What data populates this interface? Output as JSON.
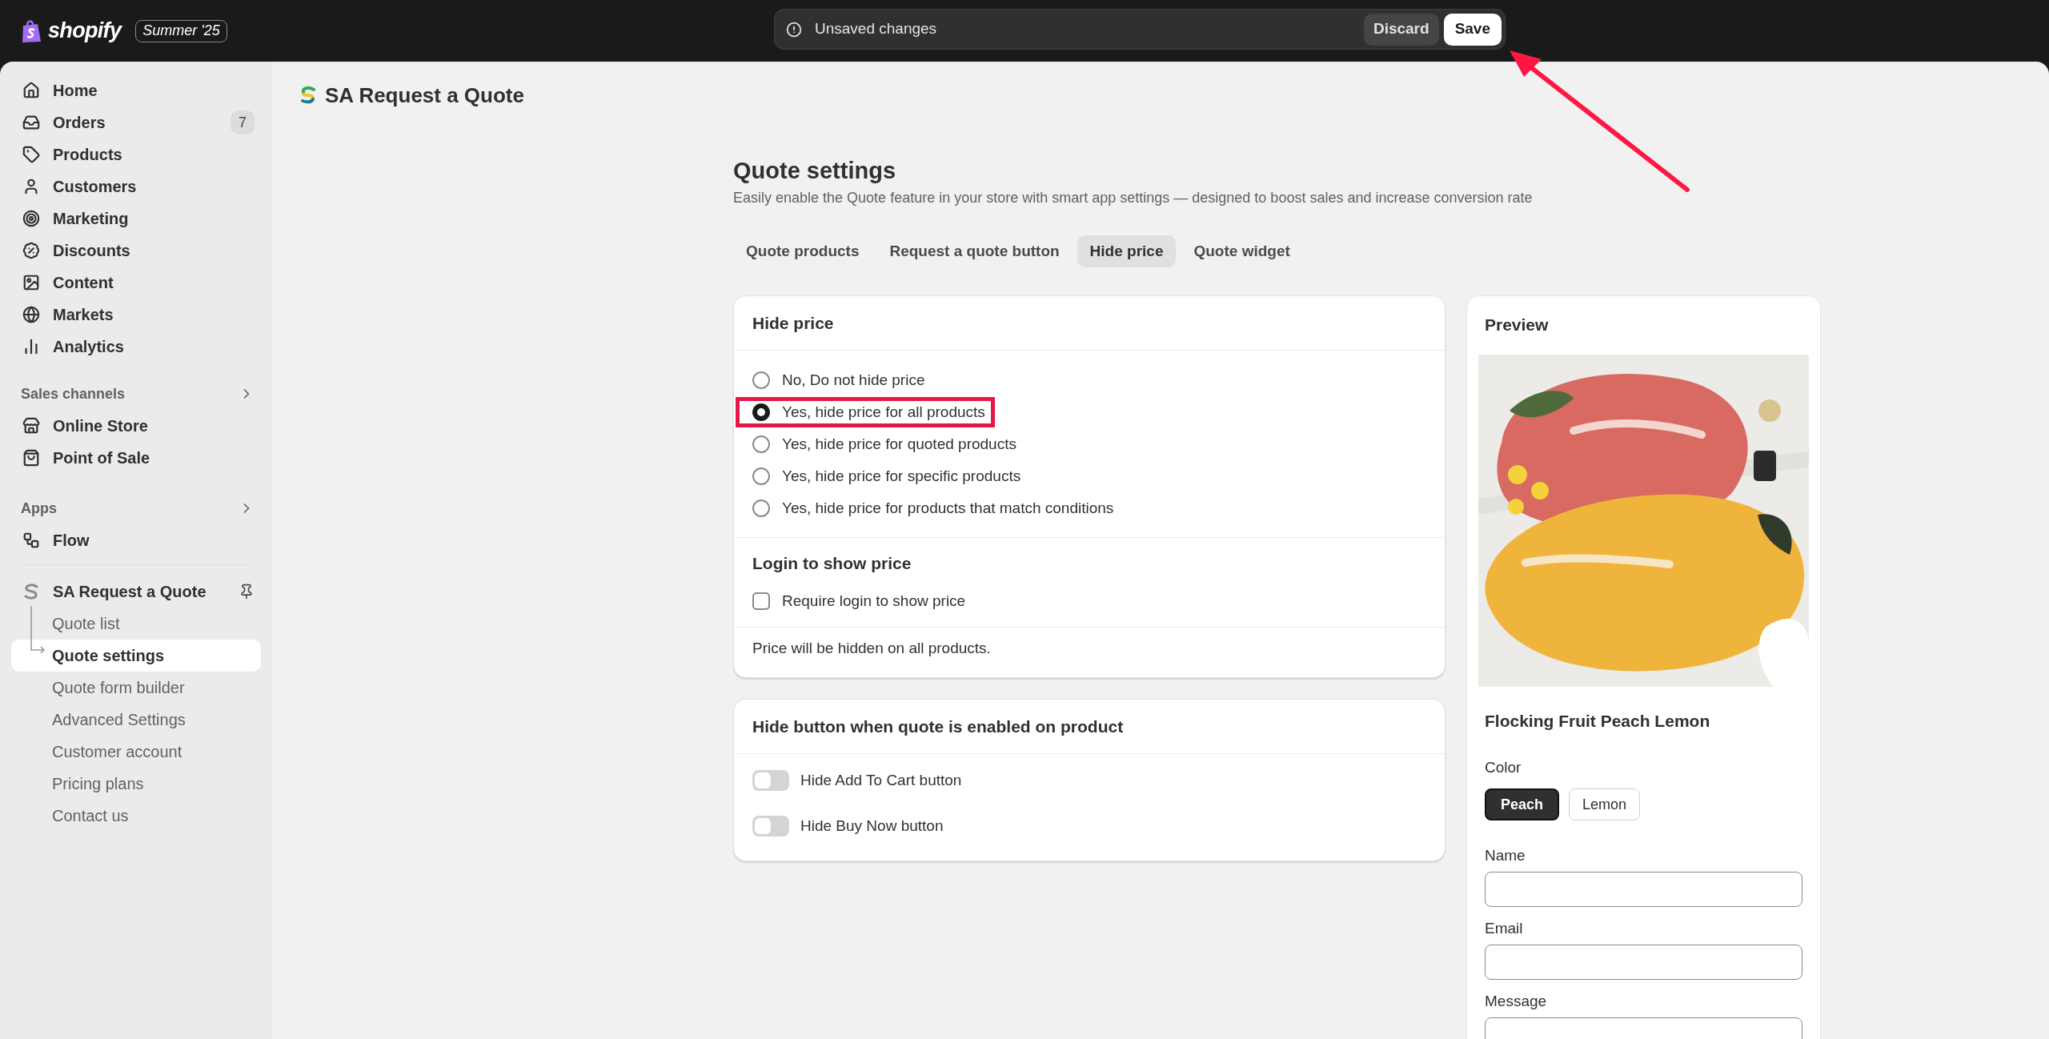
{
  "topbar": {
    "brand": "shopify",
    "edition": "Summer '25",
    "notice": "Unsaved changes",
    "buttons": [
      {
        "label": "Discard",
        "kind": "secondary"
      },
      {
        "label": "Save",
        "kind": "primary"
      }
    ]
  },
  "sidebar": {
    "items": [
      {
        "label": "Home"
      },
      {
        "label": "Orders",
        "badge": "7"
      },
      {
        "label": "Products"
      },
      {
        "label": "Customers"
      },
      {
        "label": "Marketing"
      },
      {
        "label": "Discounts"
      },
      {
        "label": "Content"
      },
      {
        "label": "Markets"
      },
      {
        "label": "Analytics"
      }
    ],
    "sections": [
      {
        "title": "Sales channels",
        "items": [
          {
            "label": "Online Store"
          },
          {
            "label": "Point of Sale"
          }
        ]
      },
      {
        "title": "Apps",
        "items": [
          {
            "label": "Flow"
          }
        ]
      }
    ],
    "app": {
      "name": "SA Request a Quote",
      "children": [
        {
          "label": "Quote list",
          "selected": false
        },
        {
          "label": "Quote settings",
          "selected": true
        },
        {
          "label": "Quote form builder",
          "selected": false
        },
        {
          "label": "Advanced Settings",
          "selected": false
        },
        {
          "label": "Customer account",
          "selected": false
        },
        {
          "label": "Pricing plans",
          "selected": false
        },
        {
          "label": "Contact us",
          "selected": false
        }
      ]
    }
  },
  "header": {
    "app_title": "SA Request a Quote"
  },
  "page": {
    "title": "Quote settings",
    "subtitle": "Easily enable the Quote feature in your store with smart app settings — designed to boost sales and increase conversion rate",
    "tabs": [
      {
        "label": "Quote products",
        "selected": false
      },
      {
        "label": "Request a quote button",
        "selected": false
      },
      {
        "label": "Hide price",
        "selected": true
      },
      {
        "label": "Quote widget",
        "selected": false
      }
    ]
  },
  "hide_price": {
    "title": "Hide price",
    "options": [
      {
        "label": "No, Do not hide price",
        "selected": false,
        "highlighted": false
      },
      {
        "label": "Yes, hide price for all products",
        "selected": true,
        "highlighted": true
      },
      {
        "label": "Yes, hide price for quoted products",
        "selected": false,
        "highlighted": false
      },
      {
        "label": "Yes, hide price for specific products",
        "selected": false,
        "highlighted": false
      },
      {
        "label": "Yes, hide price for products that match conditions",
        "selected": false,
        "highlighted": false
      }
    ],
    "login_title": "Login to show price",
    "login_checkbox": {
      "label": "Require login to show price",
      "checked": false
    },
    "note": "Price will be hidden on all products."
  },
  "hide_button": {
    "title": "Hide button when quote is enabled on product",
    "toggles": [
      {
        "label": "Hide Add To Cart button",
        "on": false
      },
      {
        "label": "Hide Buy Now button",
        "on": false
      }
    ]
  },
  "preview": {
    "title": "Preview",
    "product_name": "Flocking Fruit Peach Lemon",
    "color_label": "Color",
    "swatches": [
      {
        "label": "Peach",
        "selected": true
      },
      {
        "label": "Lemon",
        "selected": false
      }
    ],
    "fields": [
      {
        "label": "Name"
      },
      {
        "label": "Email"
      },
      {
        "label": "Message"
      }
    ]
  }
}
